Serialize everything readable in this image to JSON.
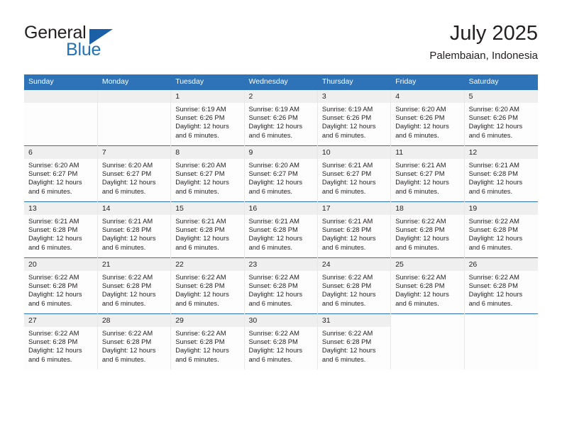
{
  "brand": {
    "name_part1": "General",
    "name_part2": "Blue",
    "accent_color": "#2272b8",
    "triangle_color": "#1b5fa6"
  },
  "header": {
    "title": "July 2025",
    "subtitle": "Palembaian, Indonesia"
  },
  "theme": {
    "header_band": "#2e72b8",
    "daynum_strip": "#efefef",
    "text": "#231f20"
  },
  "weekdays": [
    "Sunday",
    "Monday",
    "Tuesday",
    "Wednesday",
    "Thursday",
    "Friday",
    "Saturday"
  ],
  "labels": {
    "sunrise_prefix": "Sunrise: ",
    "sunset_prefix": "Sunset: ",
    "daylight_prefix": "Daylight: "
  },
  "weeks": [
    [
      {
        "day": "",
        "sunrise": "",
        "sunset": "",
        "daylight": "",
        "empty": true
      },
      {
        "day": "",
        "sunrise": "",
        "sunset": "",
        "daylight": "",
        "empty": true
      },
      {
        "day": "1",
        "sunrise": "Sunrise: 6:19 AM",
        "sunset": "Sunset: 6:26 PM",
        "daylight": "Daylight: 12 hours and 6 minutes."
      },
      {
        "day": "2",
        "sunrise": "Sunrise: 6:19 AM",
        "sunset": "Sunset: 6:26 PM",
        "daylight": "Daylight: 12 hours and 6 minutes."
      },
      {
        "day": "3",
        "sunrise": "Sunrise: 6:19 AM",
        "sunset": "Sunset: 6:26 PM",
        "daylight": "Daylight: 12 hours and 6 minutes."
      },
      {
        "day": "4",
        "sunrise": "Sunrise: 6:20 AM",
        "sunset": "Sunset: 6:26 PM",
        "daylight": "Daylight: 12 hours and 6 minutes."
      },
      {
        "day": "5",
        "sunrise": "Sunrise: 6:20 AM",
        "sunset": "Sunset: 6:26 PM",
        "daylight": "Daylight: 12 hours and 6 minutes."
      }
    ],
    [
      {
        "day": "6",
        "sunrise": "Sunrise: 6:20 AM",
        "sunset": "Sunset: 6:27 PM",
        "daylight": "Daylight: 12 hours and 6 minutes."
      },
      {
        "day": "7",
        "sunrise": "Sunrise: 6:20 AM",
        "sunset": "Sunset: 6:27 PM",
        "daylight": "Daylight: 12 hours and 6 minutes."
      },
      {
        "day": "8",
        "sunrise": "Sunrise: 6:20 AM",
        "sunset": "Sunset: 6:27 PM",
        "daylight": "Daylight: 12 hours and 6 minutes."
      },
      {
        "day": "9",
        "sunrise": "Sunrise: 6:20 AM",
        "sunset": "Sunset: 6:27 PM",
        "daylight": "Daylight: 12 hours and 6 minutes."
      },
      {
        "day": "10",
        "sunrise": "Sunrise: 6:21 AM",
        "sunset": "Sunset: 6:27 PM",
        "daylight": "Daylight: 12 hours and 6 minutes."
      },
      {
        "day": "11",
        "sunrise": "Sunrise: 6:21 AM",
        "sunset": "Sunset: 6:27 PM",
        "daylight": "Daylight: 12 hours and 6 minutes."
      },
      {
        "day": "12",
        "sunrise": "Sunrise: 6:21 AM",
        "sunset": "Sunset: 6:28 PM",
        "daylight": "Daylight: 12 hours and 6 minutes."
      }
    ],
    [
      {
        "day": "13",
        "sunrise": "Sunrise: 6:21 AM",
        "sunset": "Sunset: 6:28 PM",
        "daylight": "Daylight: 12 hours and 6 minutes."
      },
      {
        "day": "14",
        "sunrise": "Sunrise: 6:21 AM",
        "sunset": "Sunset: 6:28 PM",
        "daylight": "Daylight: 12 hours and 6 minutes."
      },
      {
        "day": "15",
        "sunrise": "Sunrise: 6:21 AM",
        "sunset": "Sunset: 6:28 PM",
        "daylight": "Daylight: 12 hours and 6 minutes."
      },
      {
        "day": "16",
        "sunrise": "Sunrise: 6:21 AM",
        "sunset": "Sunset: 6:28 PM",
        "daylight": "Daylight: 12 hours and 6 minutes."
      },
      {
        "day": "17",
        "sunrise": "Sunrise: 6:21 AM",
        "sunset": "Sunset: 6:28 PM",
        "daylight": "Daylight: 12 hours and 6 minutes."
      },
      {
        "day": "18",
        "sunrise": "Sunrise: 6:22 AM",
        "sunset": "Sunset: 6:28 PM",
        "daylight": "Daylight: 12 hours and 6 minutes."
      },
      {
        "day": "19",
        "sunrise": "Sunrise: 6:22 AM",
        "sunset": "Sunset: 6:28 PM",
        "daylight": "Daylight: 12 hours and 6 minutes."
      }
    ],
    [
      {
        "day": "20",
        "sunrise": "Sunrise: 6:22 AM",
        "sunset": "Sunset: 6:28 PM",
        "daylight": "Daylight: 12 hours and 6 minutes."
      },
      {
        "day": "21",
        "sunrise": "Sunrise: 6:22 AM",
        "sunset": "Sunset: 6:28 PM",
        "daylight": "Daylight: 12 hours and 6 minutes."
      },
      {
        "day": "22",
        "sunrise": "Sunrise: 6:22 AM",
        "sunset": "Sunset: 6:28 PM",
        "daylight": "Daylight: 12 hours and 6 minutes."
      },
      {
        "day": "23",
        "sunrise": "Sunrise: 6:22 AM",
        "sunset": "Sunset: 6:28 PM",
        "daylight": "Daylight: 12 hours and 6 minutes."
      },
      {
        "day": "24",
        "sunrise": "Sunrise: 6:22 AM",
        "sunset": "Sunset: 6:28 PM",
        "daylight": "Daylight: 12 hours and 6 minutes."
      },
      {
        "day": "25",
        "sunrise": "Sunrise: 6:22 AM",
        "sunset": "Sunset: 6:28 PM",
        "daylight": "Daylight: 12 hours and 6 minutes."
      },
      {
        "day": "26",
        "sunrise": "Sunrise: 6:22 AM",
        "sunset": "Sunset: 6:28 PM",
        "daylight": "Daylight: 12 hours and 6 minutes."
      }
    ],
    [
      {
        "day": "27",
        "sunrise": "Sunrise: 6:22 AM",
        "sunset": "Sunset: 6:28 PM",
        "daylight": "Daylight: 12 hours and 6 minutes."
      },
      {
        "day": "28",
        "sunrise": "Sunrise: 6:22 AM",
        "sunset": "Sunset: 6:28 PM",
        "daylight": "Daylight: 12 hours and 6 minutes."
      },
      {
        "day": "29",
        "sunrise": "Sunrise: 6:22 AM",
        "sunset": "Sunset: 6:28 PM",
        "daylight": "Daylight: 12 hours and 6 minutes."
      },
      {
        "day": "30",
        "sunrise": "Sunrise: 6:22 AM",
        "sunset": "Sunset: 6:28 PM",
        "daylight": "Daylight: 12 hours and 6 minutes."
      },
      {
        "day": "31",
        "sunrise": "Sunrise: 6:22 AM",
        "sunset": "Sunset: 6:28 PM",
        "daylight": "Daylight: 12 hours and 6 minutes."
      },
      {
        "day": "",
        "sunrise": "",
        "sunset": "",
        "daylight": "",
        "blank": true
      },
      {
        "day": "",
        "sunrise": "",
        "sunset": "",
        "daylight": "",
        "blank": true
      }
    ]
  ]
}
